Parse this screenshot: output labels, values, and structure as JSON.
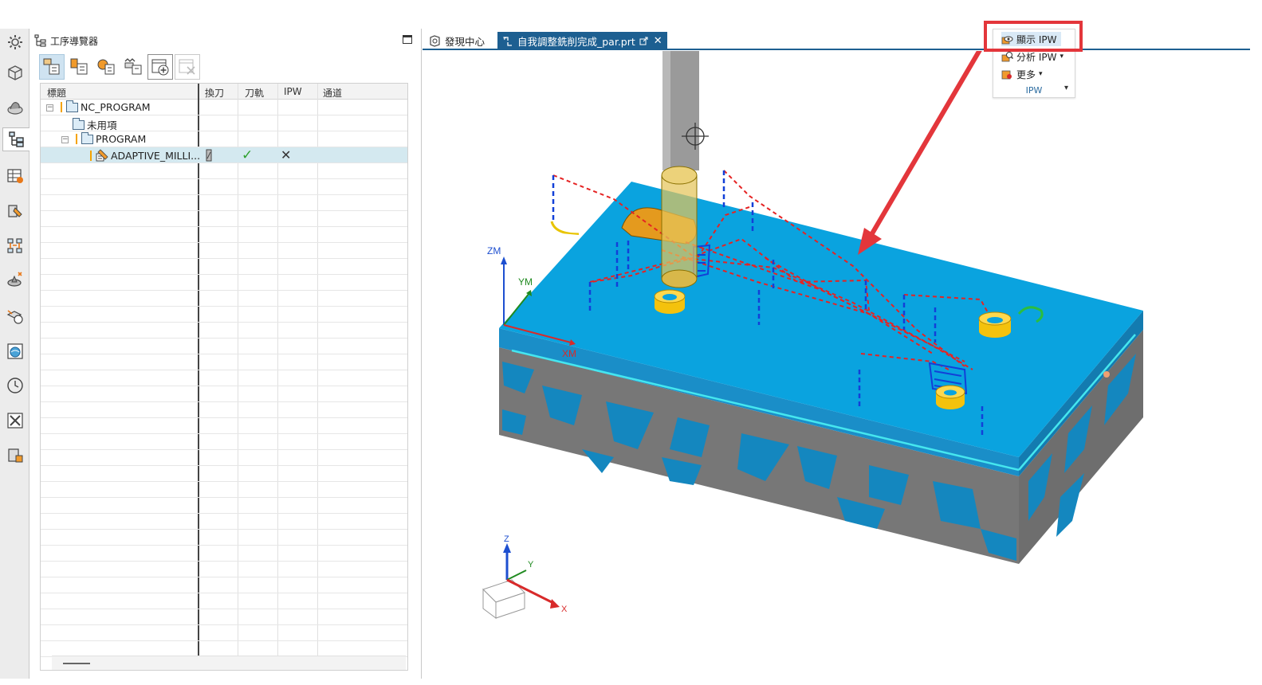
{
  "navigator": {
    "title": "工序導覽器",
    "columns": [
      "標題",
      "換刀",
      "刀軌",
      "IPW",
      "通道"
    ],
    "rows": [
      {
        "label": "NC_PROGRAM",
        "level": 0,
        "warning": true,
        "expandable": true
      },
      {
        "label": "未用項",
        "level": 1,
        "warning": false,
        "expandable": false
      },
      {
        "label": "PROGRAM",
        "level": 1,
        "warning": true,
        "expandable": true
      },
      {
        "label": "ADAPTIVE_MILLI...",
        "level": 2,
        "warning": true,
        "expandable": false,
        "toolpath_status": "✓",
        "ipw_status": "✕"
      }
    ]
  },
  "tabs": [
    {
      "label": "發現中心",
      "active": false
    },
    {
      "label": "自我調整銑削完成_par.prt",
      "active": true,
      "close": "✕"
    }
  ],
  "ribbon": {
    "items": [
      {
        "label": "顯示 IPW",
        "dropdown": false,
        "highlighted": true
      },
      {
        "label": "分析 IPW",
        "dropdown": true
      },
      {
        "label": "更多",
        "dropdown": true
      }
    ],
    "group_label": "IPW",
    "chevron": "▾"
  },
  "viewport": {
    "wcs_labels": {
      "z": "ZM",
      "y": "YM",
      "x": "XM"
    },
    "triad_labels": {
      "z": "Z",
      "y": "Y",
      "x": "X"
    }
  },
  "colors": {
    "accent": "#1d5f91",
    "highlight_red": "#e3363b",
    "stock_top": "#0aa3df",
    "toolpath_rapid": "#e52323",
    "toolpath_feed": "#1240d8",
    "hole_yellow": "#f4c20d"
  }
}
